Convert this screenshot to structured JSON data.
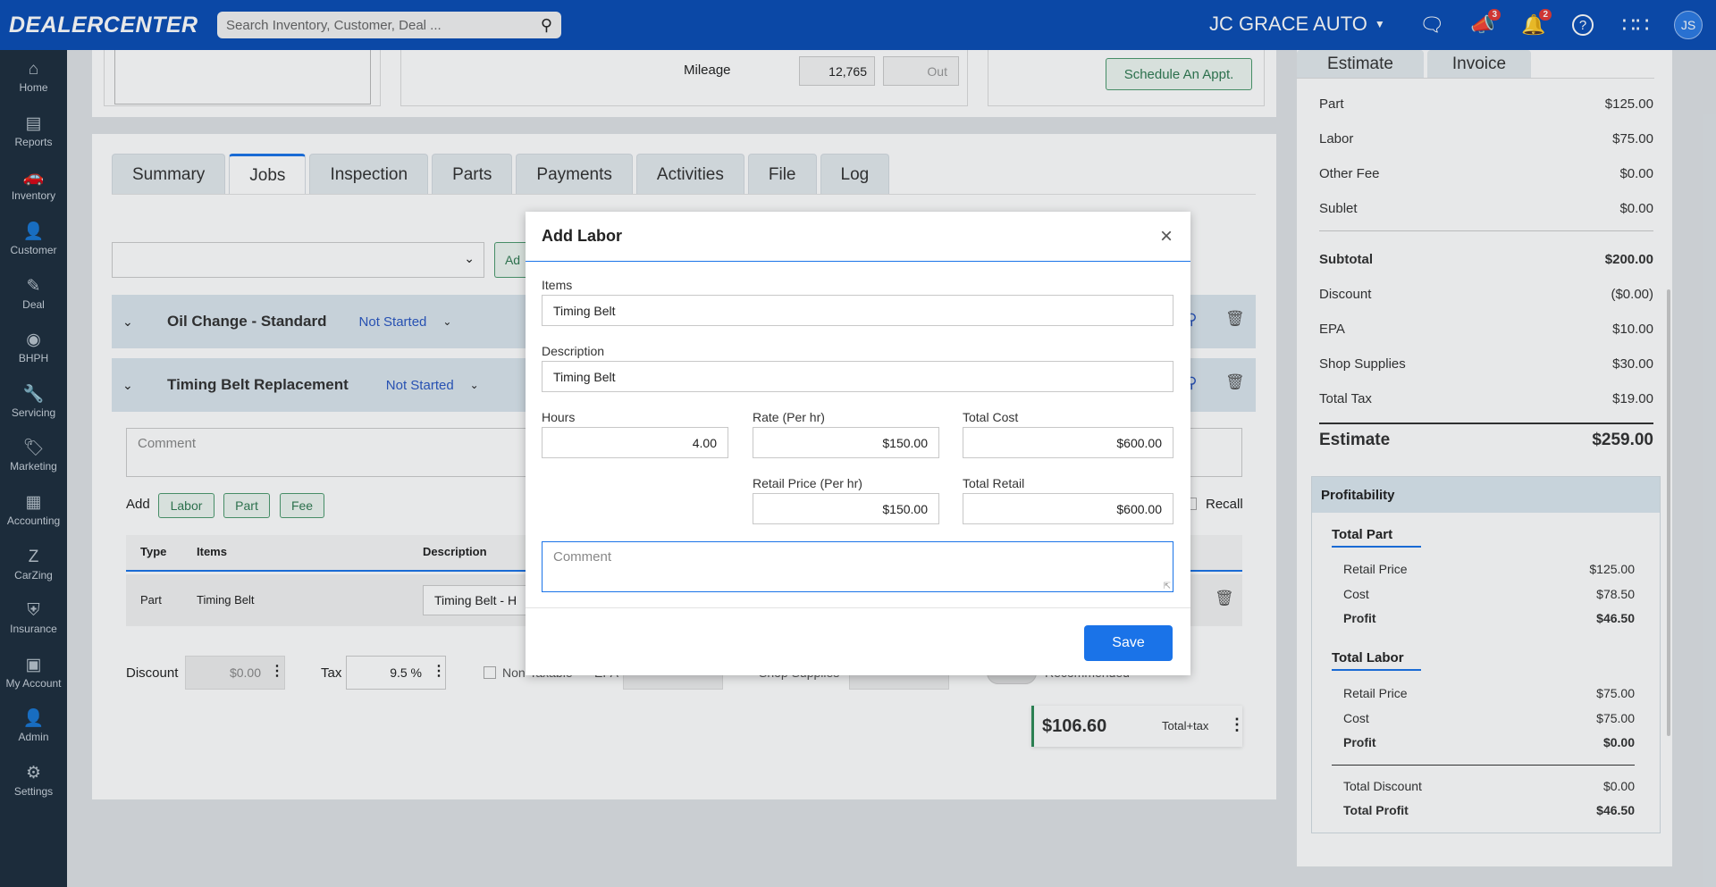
{
  "header": {
    "logo": "DEALERCENTER",
    "search_placeholder": "Search Inventory, Customer, Deal ...",
    "dealer": "JC GRACE AUTO",
    "badge_announce": "3",
    "badge_notify": "2",
    "avatar": "JS"
  },
  "sidebar": {
    "items": [
      {
        "label": "Home",
        "icon": "⌂"
      },
      {
        "label": "Reports",
        "icon": "▤"
      },
      {
        "label": "Inventory",
        "icon": "🚗"
      },
      {
        "label": "Customer",
        "icon": "👤"
      },
      {
        "label": "Deal",
        "icon": "✎"
      },
      {
        "label": "BHPH",
        "icon": "◉"
      },
      {
        "label": "Servicing",
        "icon": "🔧"
      },
      {
        "label": "Marketing",
        "icon": "🏷"
      },
      {
        "label": "Accounting",
        "icon": "▦"
      },
      {
        "label": "CarZing",
        "icon": "Z"
      },
      {
        "label": "Insurance",
        "icon": "⛨"
      },
      {
        "label": "My Account",
        "icon": "▣"
      },
      {
        "label": "Admin",
        "icon": "👤"
      },
      {
        "label": "Settings",
        "icon": "⚙"
      }
    ]
  },
  "vehicle": {
    "mileage_label": "Mileage",
    "mileage_in": "12,765",
    "mileage_out_placeholder": "Out",
    "schedule_btn": "Schedule An Appt."
  },
  "tabs": [
    "Summary",
    "Jobs",
    "Inspection",
    "Parts",
    "Payments",
    "Activities",
    "File",
    "Log"
  ],
  "jobs": {
    "add_btn": "Ad",
    "job1": {
      "title": "Oil Change - Standard",
      "status": "Not Started"
    },
    "job2": {
      "title": "Timing Belt Replacement",
      "status": "Not Started"
    },
    "comment_placeholder": "Comment",
    "add_label": "Add",
    "add_labor": "Labor",
    "add_part": "Part",
    "add_fee": "Fee",
    "recall": "Recall",
    "cols": {
      "type": "Type",
      "items": "Items",
      "description": "Description"
    },
    "row": {
      "type": "Part",
      "items": "Timing Belt",
      "description": "Timing Belt - H"
    },
    "discount_label": "Discount",
    "discount_value": "$0.00",
    "tax_label": "Tax",
    "tax_value": "9.5 %",
    "non_taxable": "Non-Taxable",
    "epa": "EPA",
    "shop_supplies": "Shop Supplies",
    "recommended": "Recommended",
    "total": "$106.60",
    "total_label": "Total+tax"
  },
  "estimate": {
    "tab_estimate": "Estimate",
    "tab_invoice": "Invoice",
    "rows": [
      {
        "label": "Part",
        "value": "$125.00"
      },
      {
        "label": "Labor",
        "value": "$75.00"
      },
      {
        "label": "Other Fee",
        "value": "$0.00"
      },
      {
        "label": "Sublet",
        "value": "$0.00"
      }
    ],
    "subtotal_label": "Subtotal",
    "subtotal": "$200.00",
    "rows2": [
      {
        "label": "Discount",
        "value": "($0.00)"
      },
      {
        "label": "EPA",
        "value": "$10.00"
      },
      {
        "label": "Shop Supplies",
        "value": "$30.00"
      },
      {
        "label": "Total Tax",
        "value": "$19.00"
      }
    ],
    "estimate_label": "Estimate",
    "estimate_total": "$259.00",
    "profitability": "Profitability",
    "total_part": "Total Part",
    "part_retail_label": "Retail Price",
    "part_retail": "$125.00",
    "part_cost_label": "Cost",
    "part_cost": "$78.50",
    "part_profit_label": "Profit",
    "part_profit": "$46.50",
    "total_labor": "Total Labor",
    "labor_retail_label": "Retail Price",
    "labor_retail": "$75.00",
    "labor_cost_label": "Cost",
    "labor_cost": "$75.00",
    "labor_profit_label": "Profit",
    "labor_profit": "$0.00",
    "total_discount_label": "Total Discount",
    "total_discount": "$0.00",
    "total_profit_label": "Total Profit",
    "total_profit": "$46.50"
  },
  "modal": {
    "title": "Add Labor",
    "items_label": "Items",
    "items_value": "Timing Belt",
    "desc_label": "Description",
    "desc_value": "Timing Belt",
    "hours_label": "Hours",
    "hours_value": "4.00",
    "rate_label": "Rate (Per hr)",
    "rate_value": "$150.00",
    "total_cost_label": "Total Cost",
    "total_cost_value": "$600.00",
    "retail_label": "Retail Price (Per hr)",
    "retail_value": "$150.00",
    "total_retail_label": "Total Retail",
    "total_retail_value": "$600.00",
    "comment_placeholder": "Comment",
    "save": "Save"
  }
}
